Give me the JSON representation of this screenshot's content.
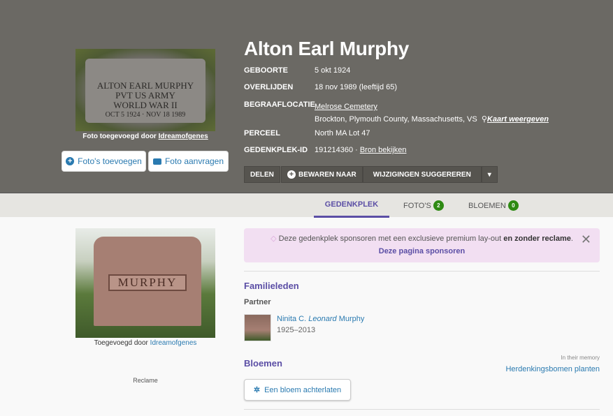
{
  "memorial": {
    "name": "Alton Earl Murphy",
    "birth_label": "GEBOORTE",
    "birth": "5 okt 1924",
    "death_label": "OVERLIJDEN",
    "death": "18 nov 1989 (leeftijd 65)",
    "burial_label": "BEGRAAFLOCATIE",
    "cemetery": "Melrose Cemetery",
    "location": "Brockton, Plymouth County, Massachusetts, VS",
    "map_link": "Kaart weergeven",
    "plot_label": "PERCEEL",
    "plot": "North MA Lot 47",
    "id_label": "GEDENKPLEK-ID",
    "id": "191214360 ·",
    "source_link": "Bron bekijken"
  },
  "photo": {
    "stone_text": [
      "ALTON EARL MURPHY",
      "PVT US ARMY",
      "WORLD WAR II",
      "OCT 5 1924 · NOV 18 1989"
    ],
    "caption_prefix": "Foto toegevoegd door",
    "caption_user": "Idreamofgenes",
    "add_button": "Foto's toevoegen",
    "request_button": "Foto aanvragen"
  },
  "actions": {
    "share": "DELEN",
    "save": "BEWAREN NAAR",
    "suggest": "WIJZIGINGEN SUGGEREREN"
  },
  "tabs": [
    {
      "label": "GEDENKPLEK"
    },
    {
      "label": "FOTO'S",
      "count": "2"
    },
    {
      "label": "BLOEMEN",
      "count": "0"
    }
  ],
  "side": {
    "stone_name": "MURPHY",
    "caption_prefix": "Toegevoegd door",
    "caption_user": "Idreamofgenes",
    "ad_label": "Reclame"
  },
  "sponsor": {
    "text": "Deze gedenkplek sponsoren met een exclusieve premium lay-out",
    "bold": "en zonder reclame",
    "link": "Deze pagina sponsoren"
  },
  "family": {
    "title": "Familieleden",
    "relation": "Partner",
    "member_first": "Ninita C.",
    "member_maiden": "Leonard",
    "member_last": "Murphy",
    "member_years": "1925–2013"
  },
  "flowers": {
    "title": "Bloemen",
    "memory_label": "In their memory",
    "trees_link": "Herdenkingsbomen planten",
    "leave_button": "Een bloem achterlaten"
  },
  "colors": {
    "hero": "#6b6964",
    "accent": "#5b4ea5",
    "link": "#2a7ab0",
    "badge": "#2e8a13"
  }
}
